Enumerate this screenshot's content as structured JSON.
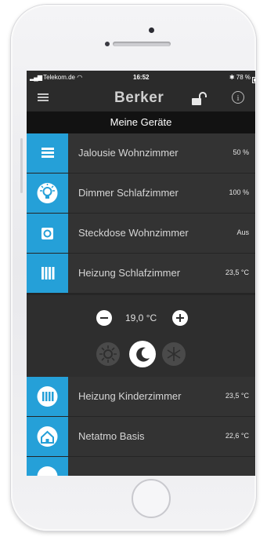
{
  "status_bar": {
    "carrier": "Telekom.de",
    "time": "16:52",
    "battery": "78 %"
  },
  "app_bar": {
    "brand": "Berker"
  },
  "section_title": "Meine Geräte",
  "devices": [
    {
      "name": "Jalousie Wohnzimmer",
      "value": "50 %",
      "icon": "blinds-icon"
    },
    {
      "name": "Dimmer Schlafzimmer",
      "value": "100 %",
      "icon": "dimmer-bulb-icon"
    },
    {
      "name": "Steckdose Wohnzimmer",
      "value": "Aus",
      "icon": "socket-icon"
    },
    {
      "name": "Heizung Schlafzimmer",
      "value": "23,5 °C",
      "icon": "radiator-icon"
    },
    {
      "name": "Heizung Kinderzimmer",
      "value": "23,5 °C",
      "icon": "radiator-icon"
    },
    {
      "name": "Netatmo Basis",
      "value": "22,6 °C",
      "icon": "house-icon"
    }
  ],
  "thermostat": {
    "setpoint": "19,0 °C",
    "active_mode": "night"
  },
  "colors": {
    "accent": "#25a0d8",
    "background": "#262626",
    "row": "#333333"
  }
}
